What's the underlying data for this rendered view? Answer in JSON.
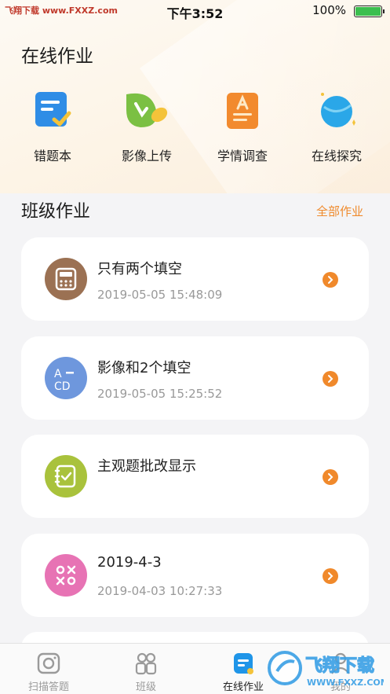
{
  "status_bar": {
    "carrier": "飞翔下载 www.FXXZ.com",
    "time": "下午3:52",
    "battery": "100%",
    "battery_level": 1.0
  },
  "page_title": "在线作业",
  "tools": [
    {
      "label": "错题本",
      "icon": "notebook-check-icon"
    },
    {
      "label": "影像上传",
      "icon": "leaf-upload-icon"
    },
    {
      "label": "学情调查",
      "icon": "survey-doc-icon"
    },
    {
      "label": "在线探究",
      "icon": "planet-icon"
    }
  ],
  "section": {
    "title": "班级作业",
    "link": "全部作业"
  },
  "assignments": [
    {
      "title": "只有两个填空",
      "time": "2019-05-05 15:48:09",
      "icon": "calculator-icon",
      "color": "#9b7153"
    },
    {
      "title": "影像和2个填空",
      "time": "2019-05-05 15:25:52",
      "icon": "abcd-icon",
      "color": "#6e97dd"
    },
    {
      "title": "主观题批改显示",
      "time": "",
      "icon": "checklist-icon",
      "color": "#a9c23c"
    },
    {
      "title": "2019-4-3",
      "time": "2019-04-03 10:27:33",
      "icon": "tic-tac-toe-icon",
      "color": "#e773b4"
    }
  ],
  "tabbar": [
    {
      "label": "扫描答题",
      "icon": "camera-icon",
      "active": false
    },
    {
      "label": "班级",
      "icon": "people-icon",
      "active": false
    },
    {
      "label": "在线作业",
      "icon": "homework-icon",
      "active": true
    },
    {
      "label": "我的",
      "icon": "person-icon",
      "active": false
    }
  ],
  "watermark": {
    "brand": "飞翔下载",
    "url": "WWW.FXXZ.COM"
  },
  "colors": {
    "accent": "#ef8a2c",
    "active_tab": "#1f95e8"
  }
}
